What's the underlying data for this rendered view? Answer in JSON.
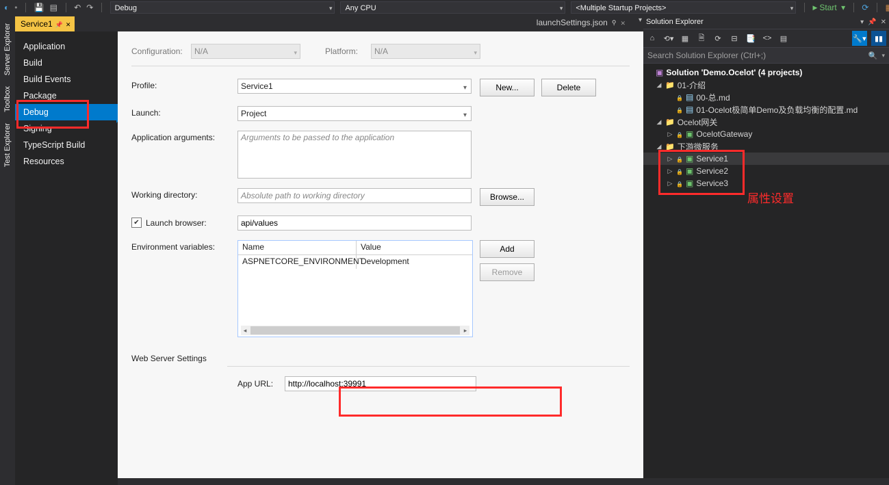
{
  "toolbar": {
    "config": "Debug",
    "platform": "Any CPU",
    "startup": "<Multiple Startup Projects>",
    "start": "Start"
  },
  "side_tabs": [
    "Server Explorer",
    "Toolbox",
    "Test Explorer"
  ],
  "doc_tabs": {
    "active": "Service1",
    "inactive": "launchSettings.json"
  },
  "left_nav": [
    "Application",
    "Build",
    "Build Events",
    "Package",
    "Debug",
    "Signing",
    "TypeScript Build",
    "Resources"
  ],
  "left_nav_selected": "Debug",
  "cfg": {
    "configuration_label": "Configuration:",
    "configuration_value": "N/A",
    "platform_label": "Platform:",
    "platform_value": "N/A"
  },
  "form": {
    "profile_label": "Profile:",
    "profile_value": "Service1",
    "new_btn": "New...",
    "delete_btn": "Delete",
    "launch_label": "Launch:",
    "launch_value": "Project",
    "args_label": "Application arguments:",
    "args_placeholder": "Arguments to be passed to the application",
    "wd_label": "Working directory:",
    "wd_placeholder": "Absolute path to working directory",
    "browse_btn": "Browse...",
    "lb_label": "Launch browser:",
    "lb_checked": true,
    "lb_value": "api/values",
    "env_label": "Environment variables:",
    "env_headers": {
      "name": "Name",
      "value": "Value"
    },
    "env_rows": [
      {
        "name": "ASPNETCORE_ENVIRONMENT",
        "value": "Development"
      }
    ],
    "add_btn": "Add",
    "remove_btn": "Remove",
    "wss_label": "Web Server Settings",
    "appurl_label": "App URL:",
    "appurl_value": "http://localhost:39991"
  },
  "solution_explorer": {
    "title": "Solution Explorer",
    "search_placeholder": "Search Solution Explorer (Ctrl+;)",
    "solution": "Solution 'Demo.Ocelot' (4 projects)",
    "folder1": "01-介绍",
    "file1": "00-总.md",
    "file2": "01-Ocelot极简单Demo及负载均衡的配置.md",
    "folder2": "Ocelot网关",
    "proj_gateway": "OcelotGateway",
    "folder3": "下游微服务",
    "services": [
      "Service1",
      "Service2",
      "Service3"
    ]
  },
  "annotation": "属性设置"
}
